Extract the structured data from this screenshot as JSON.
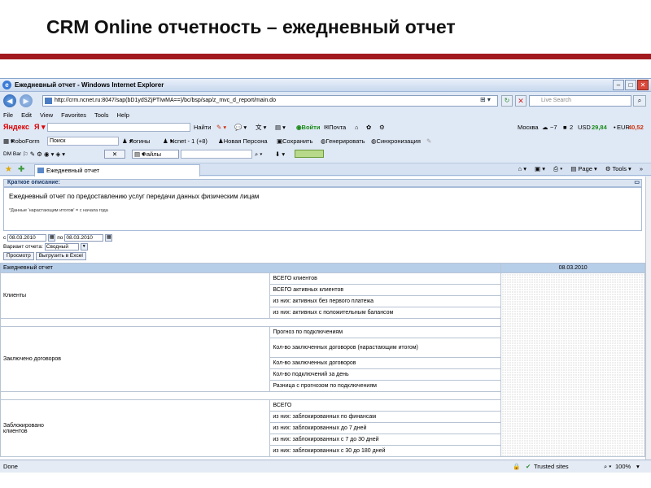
{
  "slide_title": "CRM Online отчетность – ежедневный отчет",
  "window": {
    "title": "Ежедневный отчет - Windows Internet Explorer",
    "address": "http://crm.ncnet.ru:8047/sap(bD1ydSZjPTIwMA==)/bc/bsp/sap/z_mvc_d_report/main.do",
    "search_placeholder": "Live Search"
  },
  "menu": [
    "File",
    "Edit",
    "View",
    "Favorites",
    "Tools",
    "Help"
  ],
  "toolbar1": {
    "yandex": "Яндекс",
    "find": "Найти",
    "login": "Войти",
    "mail": "Почта",
    "city": "Москва",
    "temp": "−7",
    "traffic": "2",
    "usd_label": "USD",
    "usd_value": "29,84",
    "eur_label": "EUR",
    "eur_value": "40,52"
  },
  "toolbar2": {
    "roboform": "RoboForm",
    "search": "Поиск",
    "logins": "Логины",
    "ncnet": "Ncnet - 1 (+8)",
    "new_person": "Новая Персона",
    "save": "Сохранить",
    "generate": "Генерировать",
    "sync": "Синхронизация"
  },
  "toolbar3": {
    "dmbar": "DM Bar",
    "files": "Файлы"
  },
  "tab": {
    "label": "Ежедневный отчет",
    "page": "Page",
    "tools": "Tools"
  },
  "description": {
    "header": "Краткое описание:",
    "text": "Ежедневный отчет по предоставлению услуг передачи данных физическим лицам",
    "note": "*Данные 'нарастающим итогом' = с начала года"
  },
  "filters": {
    "from_label": "с",
    "from_value": "08.03.2010",
    "to_label": "по",
    "to_value": "08.03.2010",
    "variant_label": "Вариант отчета:",
    "variant_value": "Сводный",
    "preview": "Просмотр",
    "export": "Выгрузить в Excel"
  },
  "report": {
    "title": "Ежедневный отчет",
    "date": "08.03.2010",
    "groups": [
      {
        "name": "Клиенты",
        "rows": [
          "ВСЕГО клиентов",
          "ВСЕГО активных клиентов",
          "из них: активных без первого платежа",
          "из них: активных с положительным балансом"
        ]
      },
      {
        "name": "Заключено договоров",
        "rows": [
          "Прогноз по подключениям",
          "Кол-во заключенных договоров (нарастающим итогом)",
          "Кол-во заключенных договоров",
          "Кол-во подключений за день",
          "Разница с прогнозом по подключениям"
        ]
      },
      {
        "name": "Заблокировано клиентов",
        "rows": [
          "ВСЕГО",
          "из них: заблокированных по финансам",
          "из них: заблокированных до 7 дней",
          "из них: заблокированных с 7 до 30 дней",
          "из них: заблокированных с 30 до 180 дней"
        ]
      }
    ]
  },
  "status": {
    "left": "Done",
    "zone": "Trusted sites",
    "zoom": "100%"
  }
}
